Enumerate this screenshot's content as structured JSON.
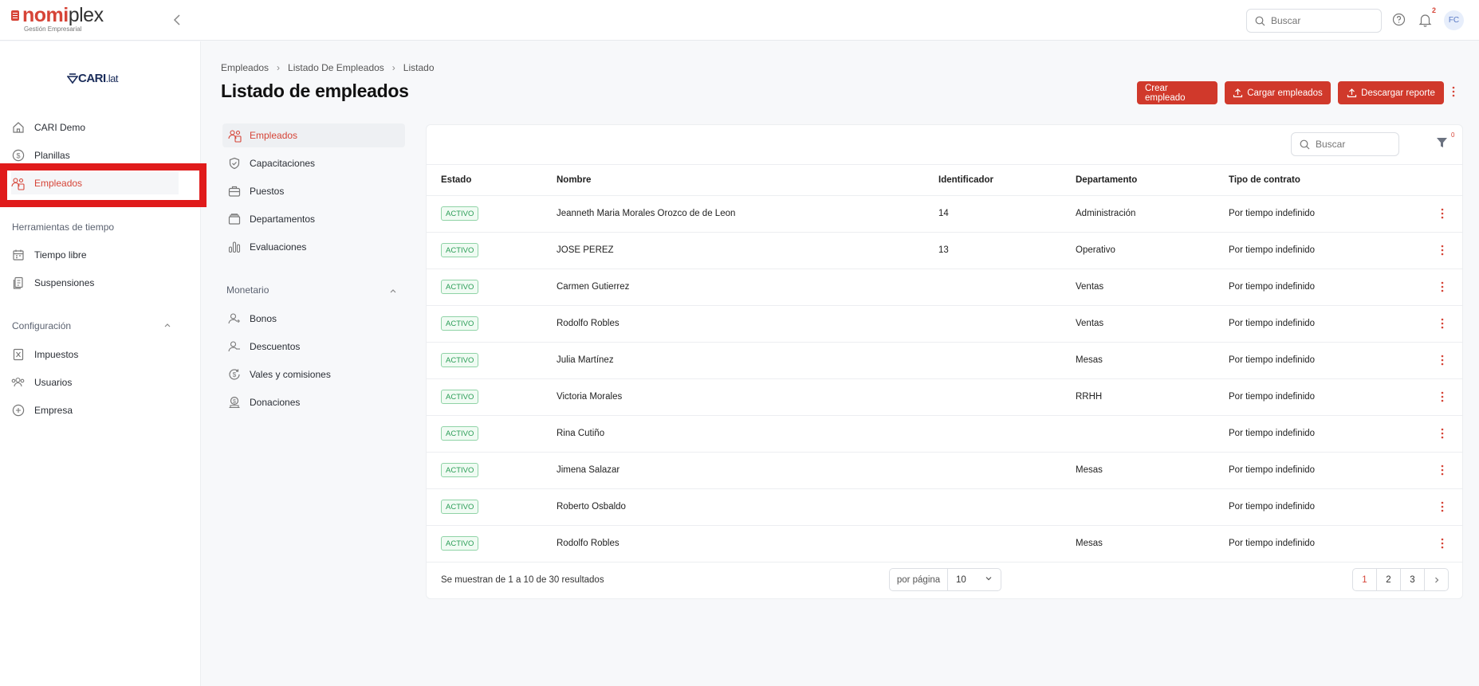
{
  "app": {
    "logo_part1": "nomi",
    "logo_part2": "plex",
    "logo_subtitle": "Gestión Empresarial",
    "search_placeholder": "Buscar",
    "notification_count": "2",
    "avatar_initials": "FC"
  },
  "sidebar": {
    "brand_main": "CARI",
    "brand_suffix": ".lat",
    "items": [
      {
        "label": "CARI Demo",
        "icon": "home-icon"
      },
      {
        "label": "Planillas",
        "icon": "dollar-circle-icon"
      },
      {
        "label": "Empleados",
        "icon": "people-icon"
      }
    ],
    "section_time": "Herramientas de tiempo",
    "time_items": [
      {
        "label": "Tiempo libre",
        "icon": "calendar-icon"
      },
      {
        "label": "Suspensiones",
        "icon": "document-icon"
      }
    ],
    "section_config": "Configuración",
    "config_items": [
      {
        "label": "Impuestos",
        "icon": "tax-icon"
      },
      {
        "label": "Usuarios",
        "icon": "users-icon"
      },
      {
        "label": "Empresa",
        "icon": "company-icon"
      }
    ]
  },
  "breadcrumb": [
    "Empleados",
    "Listado De Empleados",
    "Listado"
  ],
  "page": {
    "title": "Listado de empleados",
    "btn_create": "Crear empleado",
    "btn_upload": "Cargar empleados",
    "btn_download": "Descargar reporte"
  },
  "subnav": {
    "items": [
      {
        "label": "Empleados",
        "icon": "people-icon"
      },
      {
        "label": "Capacitaciones",
        "icon": "shield-check-icon"
      },
      {
        "label": "Puestos",
        "icon": "briefcase-icon"
      },
      {
        "label": "Departamentos",
        "icon": "folder-icon"
      },
      {
        "label": "Evaluaciones",
        "icon": "bar-chart-icon"
      }
    ],
    "section_monetario": "Monetario",
    "money_items": [
      {
        "label": "Bonos",
        "icon": "user-plus-icon"
      },
      {
        "label": "Descuentos",
        "icon": "user-minus-icon"
      },
      {
        "label": "Vales y comisiones",
        "icon": "dollar-cycle-icon"
      },
      {
        "label": "Donaciones",
        "icon": "donation-icon"
      }
    ]
  },
  "table": {
    "search_placeholder": "Buscar",
    "filter_count": "0",
    "columns": [
      "Estado",
      "Nombre",
      "Identificador",
      "Departamento",
      "Tipo de contrato"
    ],
    "rows": [
      {
        "estado": "ACTIVO",
        "nombre": "Jeanneth Maria Morales Orozco de de Leon",
        "id": "14",
        "depto": "Administración",
        "contrato": "Por tiempo indefinido"
      },
      {
        "estado": "ACTIVO",
        "nombre": "JOSE PEREZ",
        "id": "13",
        "depto": "Operativo",
        "contrato": "Por tiempo indefinido"
      },
      {
        "estado": "ACTIVO",
        "nombre": "Carmen Gutierrez",
        "id": "",
        "depto": "Ventas",
        "contrato": "Por tiempo indefinido"
      },
      {
        "estado": "ACTIVO",
        "nombre": "Rodolfo Robles",
        "id": "",
        "depto": "Ventas",
        "contrato": "Por tiempo indefinido"
      },
      {
        "estado": "ACTIVO",
        "nombre": "Julia Martínez",
        "id": "",
        "depto": "Mesas",
        "contrato": "Por tiempo indefinido"
      },
      {
        "estado": "ACTIVO",
        "nombre": "Victoria Morales",
        "id": "",
        "depto": "RRHH",
        "contrato": "Por tiempo indefinido"
      },
      {
        "estado": "ACTIVO",
        "nombre": "Rina Cutiño",
        "id": "",
        "depto": "",
        "contrato": "Por tiempo indefinido"
      },
      {
        "estado": "ACTIVO",
        "nombre": "Jimena Salazar",
        "id": "",
        "depto": "Mesas",
        "contrato": "Por tiempo indefinido"
      },
      {
        "estado": "ACTIVO",
        "nombre": "Roberto Osbaldo",
        "id": "",
        "depto": "",
        "contrato": "Por tiempo indefinido"
      },
      {
        "estado": "ACTIVO",
        "nombre": "Rodolfo Robles",
        "id": "",
        "depto": "Mesas",
        "contrato": "Por tiempo indefinido"
      }
    ],
    "footer_text": "Se muestran de 1 a 10 de 30 resultados",
    "per_page_label": "por página",
    "per_page_value": "10",
    "pages": [
      "1",
      "2",
      "3"
    ]
  },
  "colors": {
    "accent": "#d0392b",
    "badge_green": "#2a9d56"
  }
}
